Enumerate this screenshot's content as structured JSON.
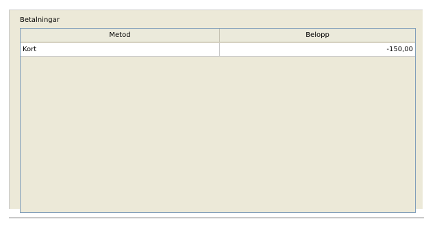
{
  "panel": {
    "title": "Betalningar"
  },
  "table": {
    "columns": [
      "Metod",
      "Belopp"
    ],
    "rows": [
      {
        "method": "Kort",
        "amount": "-150,00"
      }
    ]
  }
}
